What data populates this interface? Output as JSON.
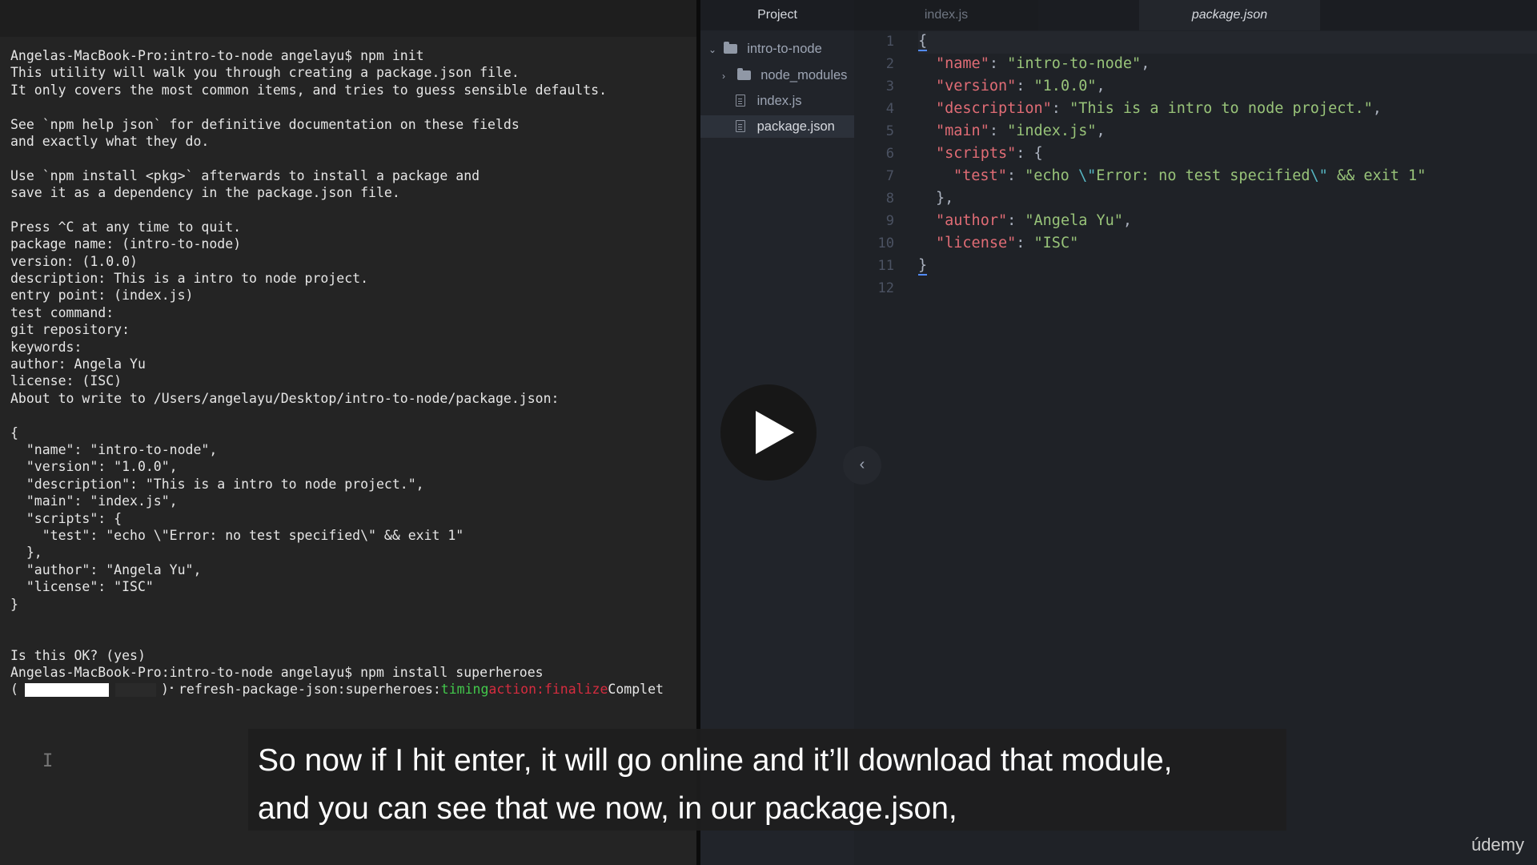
{
  "terminal": {
    "lines": [
      "Angelas-MacBook-Pro:intro-to-node angelayu$ npm init",
      "This utility will walk you through creating a package.json file.",
      "It only covers the most common items, and tries to guess sensible defaults.",
      "",
      "See `npm help json` for definitive documentation on these fields",
      "and exactly what they do.",
      "",
      "Use `npm install <pkg>` afterwards to install a package and",
      "save it as a dependency in the package.json file.",
      "",
      "Press ^C at any time to quit.",
      "package name: (intro-to-node)",
      "version: (1.0.0)",
      "description: This is a intro to node project.",
      "entry point: (index.js)",
      "test command:",
      "git repository:",
      "keywords:",
      "author: Angela Yu",
      "license: (ISC)",
      "About to write to /Users/angelayu/Desktop/intro-to-node/package.json:",
      "",
      "{",
      "  \"name\": \"intro-to-node\",",
      "  \"version\": \"1.0.0\",",
      "  \"description\": \"This is a intro to node project.\",",
      "  \"main\": \"index.js\",",
      "  \"scripts\": {",
      "    \"test\": \"echo \\\"Error: no test specified\\\" && exit 1\"",
      "  },",
      "  \"author\": \"Angela Yu\",",
      "  \"license\": \"ISC\"",
      "}",
      "",
      "",
      "Is this OK? (yes)",
      "Angelas-MacBook-Pro:intro-to-node angelayu$ npm install superheroes"
    ],
    "progress": {
      "open_bracket": "(",
      "close_bracket": ")",
      "spinner": "⠂",
      "task": "refresh-package-json:superheroes:",
      "timing": "timing",
      "action": "action:finalize",
      "status": "Complet",
      "fill": 0.67
    }
  },
  "editor": {
    "tabs": {
      "project": "Project",
      "file1": "index.js",
      "file2": "package.json"
    },
    "tree": {
      "root": "intro-to-node",
      "items": [
        "node_modules",
        "index.js",
        "package.json"
      ]
    },
    "line_numbers": [
      "1",
      "2",
      "3",
      "4",
      "5",
      "6",
      "7",
      "8",
      "9",
      "10",
      "11",
      "12"
    ],
    "code": {
      "open_brace": "{",
      "name_key": "\"name\"",
      "name_val": "\"intro-to-node\"",
      "version_key": "\"version\"",
      "version_val": "\"1.0.0\"",
      "description_key": "\"description\"",
      "description_val": "\"This is a intro to node project.\"",
      "main_key": "\"main\"",
      "main_val": "\"index.js\"",
      "scripts_key": "\"scripts\"",
      "test_key": "\"test\"",
      "test_val_a": "\"echo ",
      "test_esc1": "\\\"",
      "test_val_b": "Error: no test specified",
      "test_esc2": "\\\"",
      "test_val_c": " && exit 1\"",
      "close_scripts": "},",
      "author_key": "\"author\"",
      "author_val": "\"Angela Yu\"",
      "license_key": "\"license\"",
      "license_val": "\"ISC\"",
      "close_brace": "}"
    }
  },
  "caption": {
    "line1": "So now if I hit enter, it will go online and it’ll download that module,",
    "line2": "and you can see that we now, in our package.json,"
  },
  "brand": "údemy",
  "icons": {
    "play": "play-icon",
    "collapse": "chevron-left-icon",
    "folder": "folder-icon",
    "file": "file-icon"
  }
}
